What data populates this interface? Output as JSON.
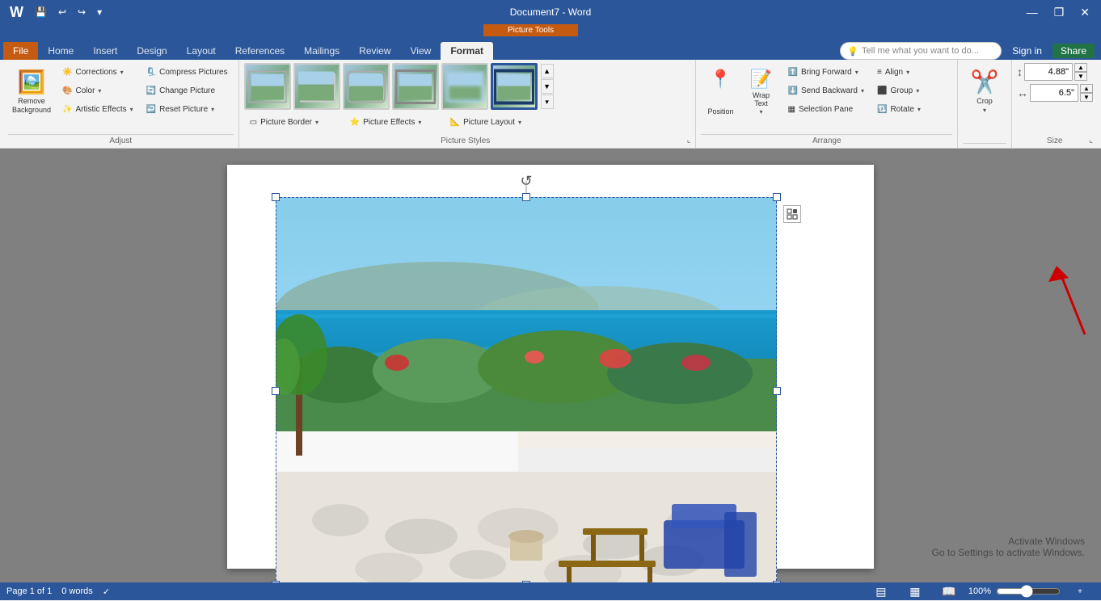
{
  "titlebar": {
    "qat_save": "💾",
    "qat_undo": "↩",
    "qat_redo": "↪",
    "qat_more": "▾",
    "title": "Document7 - Word",
    "picture_tools_label": "Picture Tools",
    "min_btn": "—",
    "restore_btn": "❐",
    "close_btn": "✕"
  },
  "ribbon_tabs": {
    "file": "File",
    "home": "Home",
    "insert": "Insert",
    "design": "Design",
    "layout": "Layout",
    "references": "References",
    "mailings": "Mailings",
    "review": "Review",
    "view": "View",
    "format": "Format"
  },
  "tell_me": {
    "placeholder": "Tell me what you want to do...",
    "icon": "💡"
  },
  "signin": "Sign in",
  "share": "Share",
  "ribbon": {
    "adjust_group": {
      "label": "Adjust",
      "remove_bg": "Remove\nBackground",
      "corrections": "Corrections",
      "color": "Color",
      "artistic_effects": "Artistic Effects",
      "compress_pictures": "Compress Pictures",
      "change_picture": "Change Picture",
      "reset_picture": "Reset Picture"
    },
    "picture_styles_group": {
      "label": "Picture Styles",
      "more_btn": "▾",
      "expand_btn": "⌞",
      "items": [
        {
          "id": 1,
          "label": "Style 1"
        },
        {
          "id": 2,
          "label": "Style 2"
        },
        {
          "id": 3,
          "label": "Style 3"
        },
        {
          "id": 4,
          "label": "Style 4"
        },
        {
          "id": 5,
          "label": "Style 5"
        },
        {
          "id": 6,
          "label": "Style 6 (selected)"
        }
      ],
      "picture_border": "Picture Border",
      "picture_effects": "Picture Effects",
      "picture_layout": "Picture Layout"
    },
    "arrange_group": {
      "label": "Arrange",
      "position": "Position",
      "wrap_text": "Wrap\nText",
      "bring_forward": "Bring Forward",
      "send_backward": "Send Backward",
      "selection_pane": "Selection Pane",
      "align": "Align",
      "group": "Group",
      "rotate": "Rotate"
    },
    "crop_group": {
      "label": "",
      "crop": "Crop"
    },
    "size_group": {
      "label": "Size",
      "height_label": "↕",
      "height_value": "4.88\"",
      "width_label": "↔",
      "width_value": "6.5\"",
      "expand_btn": "⌞"
    }
  },
  "status_bar": {
    "page": "Page 1 of 1",
    "words": "0 words",
    "proofing_icon": "✓",
    "view_icons": [
      "▤",
      "▦",
      "📖"
    ],
    "zoom": "100%",
    "zoom_slider": 100
  },
  "activate_windows": {
    "line1": "Activate Windows",
    "line2": "Go to Settings to activate Windows."
  }
}
